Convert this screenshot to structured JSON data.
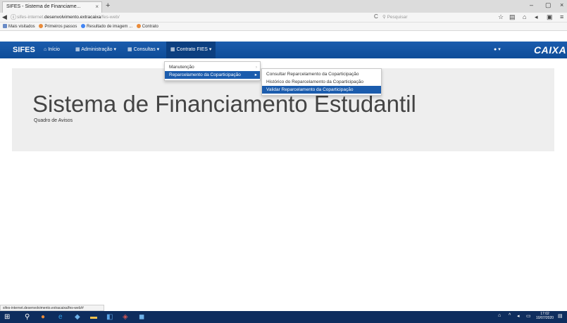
{
  "browser": {
    "tab_title": "SIFES - Sistema de Financiame...",
    "tab_close": "×",
    "new_tab": "+",
    "window_controls": [
      "–",
      "▢",
      "×"
    ],
    "url_prefix": "sifes-internet.",
    "url_domain": "desenvolvimento.extracaixa",
    "url_path": "/fes-web/",
    "search_placeholder": "Pesquisar",
    "bookmarks": [
      "Mais visitados",
      "Primeiros passos",
      "Resultado de imagem ...",
      "Contrato"
    ]
  },
  "app": {
    "brand": "SIFES",
    "nav": [
      {
        "label": "Início",
        "icon": "home-icon"
      },
      {
        "label": "Administração ▾",
        "icon": "list-icon"
      },
      {
        "label": "Consultas ▾",
        "icon": "list-icon"
      },
      {
        "label": "Contrato FIES ▾",
        "icon": "list-icon"
      }
    ],
    "user_menu": "▾",
    "logo": "CAIXA"
  },
  "menus": {
    "contrato_fies": [
      {
        "label": "Manutenção",
        "arrow": "›"
      },
      {
        "label": "Reparcelamento da Coparticipação",
        "arrow": "▸"
      }
    ],
    "reparcelamento": [
      {
        "label": "Consultar Reparcelamento da Coparticipação"
      },
      {
        "label": "Histórico do Reparcelamento da Coparticipação"
      },
      {
        "label": "Validar Reparcelamento da Coparticipação"
      }
    ]
  },
  "jumbotron": {
    "title": "Sistema de Financiamento Estudantil",
    "subtitle": "Quadro de Avisos"
  },
  "status_url": "sifes-internet.desenvolvimento.extracaixa/fes-web/#",
  "clock": {
    "time": "17:02",
    "date": "10/07/2020"
  },
  "colors": {
    "navbar": "#1b5cad",
    "highlight": "#1b5cad",
    "taskbar": "#0e2d5e"
  }
}
